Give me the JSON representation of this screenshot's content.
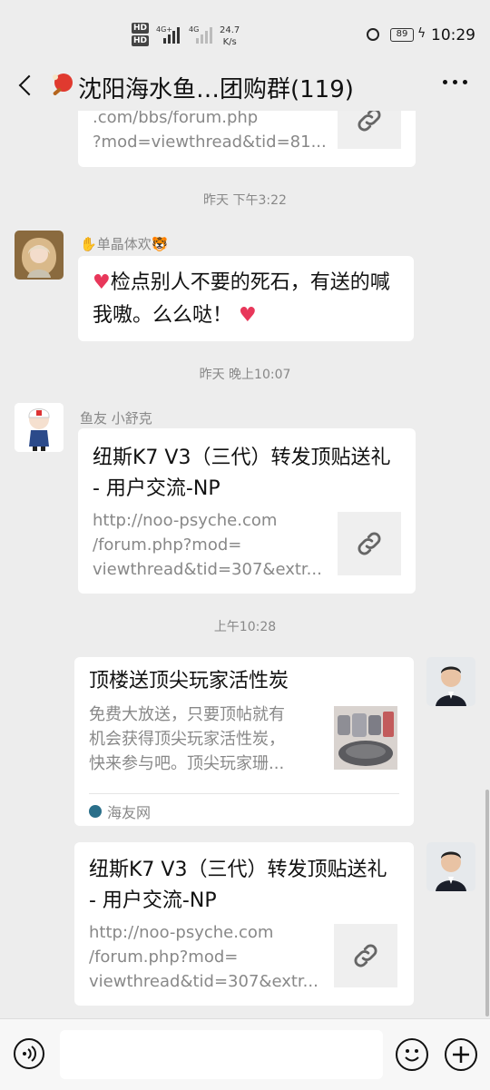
{
  "status_bar": {
    "hd1": "HD",
    "hd2": "HD",
    "net1": "4G+",
    "net2": "4G",
    "speed_value": "24.7",
    "speed_unit": "K/s",
    "battery": "89",
    "time": "10:29"
  },
  "header": {
    "title": "沈阳海水鱼…团购群(119)"
  },
  "messages": [
    {
      "desc_partial": ".com/bbs/forum.php\n?mod=viewthread&tid=81..."
    },
    {
      "timestamp": "昨天 下午3:22",
      "sender": "单晶体欢",
      "text": "检点别人不要的死石，有送的喊我嗷。么么哒！"
    },
    {
      "timestamp": "昨天 晚上10:07",
      "sender": "鱼友 小舒克",
      "title": "纽斯K7 V3（三代）转发顶贴送礼 - 用户交流-NP",
      "desc": "http://noo-psyche.com\n/forum.php?mod=\nviewthread&tid=307&extr..."
    },
    {
      "timestamp": "上午10:28",
      "title": "顶楼送顶尖玩家活性炭",
      "desc": "免费大放送，只要顶帖就有\n机会获得顶尖玩家活性炭，\n快来参与吧。顶尖玩家珊...",
      "source": "海友网"
    },
    {
      "title": "纽斯K7 V3（三代）转发顶贴送礼 - 用户交流-NP",
      "desc": "http://noo-psyche.com\n/forum.php?mod=\nviewthread&tid=307&extr..."
    }
  ],
  "colors": {
    "background": "#ededed",
    "card": "#ffffff",
    "meta_text": "#888888"
  }
}
